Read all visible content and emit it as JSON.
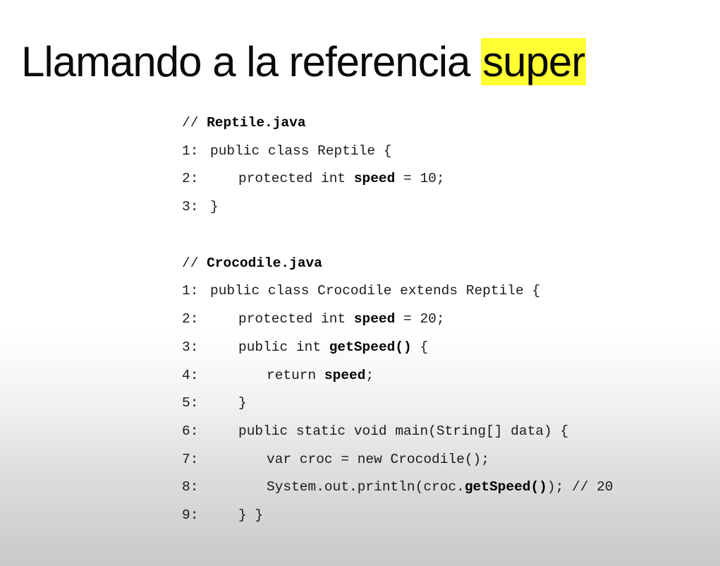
{
  "title": {
    "main": "Llamando a la referencia ",
    "highlight": "super"
  },
  "files": [
    {
      "comment": "// ",
      "filename": "Reptile.java",
      "lines": [
        {
          "num": "1:",
          "text": "public class Reptile {"
        },
        {
          "num": "2:",
          "pre": "protected int ",
          "kw": "speed",
          "post": " = 10;"
        },
        {
          "num": "3:",
          "text": "}"
        }
      ]
    },
    {
      "comment": "// ",
      "filename": "Crocodile.java",
      "lines": [
        {
          "num": "1:",
          "text": "public class Crocodile extends Reptile {"
        },
        {
          "num": "2:",
          "pre": "protected int ",
          "kw": "speed",
          "post": " = 20;"
        },
        {
          "num": "3:",
          "pre": "public int ",
          "kw": "getSpeed()",
          "post": " {"
        },
        {
          "num": "4:",
          "pre": "return ",
          "kw": "speed",
          "post": ";"
        },
        {
          "num": "5:",
          "text": "}"
        },
        {
          "num": "6:",
          "text": "public static void main(String[] data) {"
        },
        {
          "num": "7:",
          "text": "var croc = new Crocodile();"
        },
        {
          "num": "8:",
          "pre": "System.out.println(croc.",
          "kw": "getSpeed()",
          "post": "); // 20"
        },
        {
          "num": "9:",
          "text": "} }"
        }
      ]
    }
  ]
}
